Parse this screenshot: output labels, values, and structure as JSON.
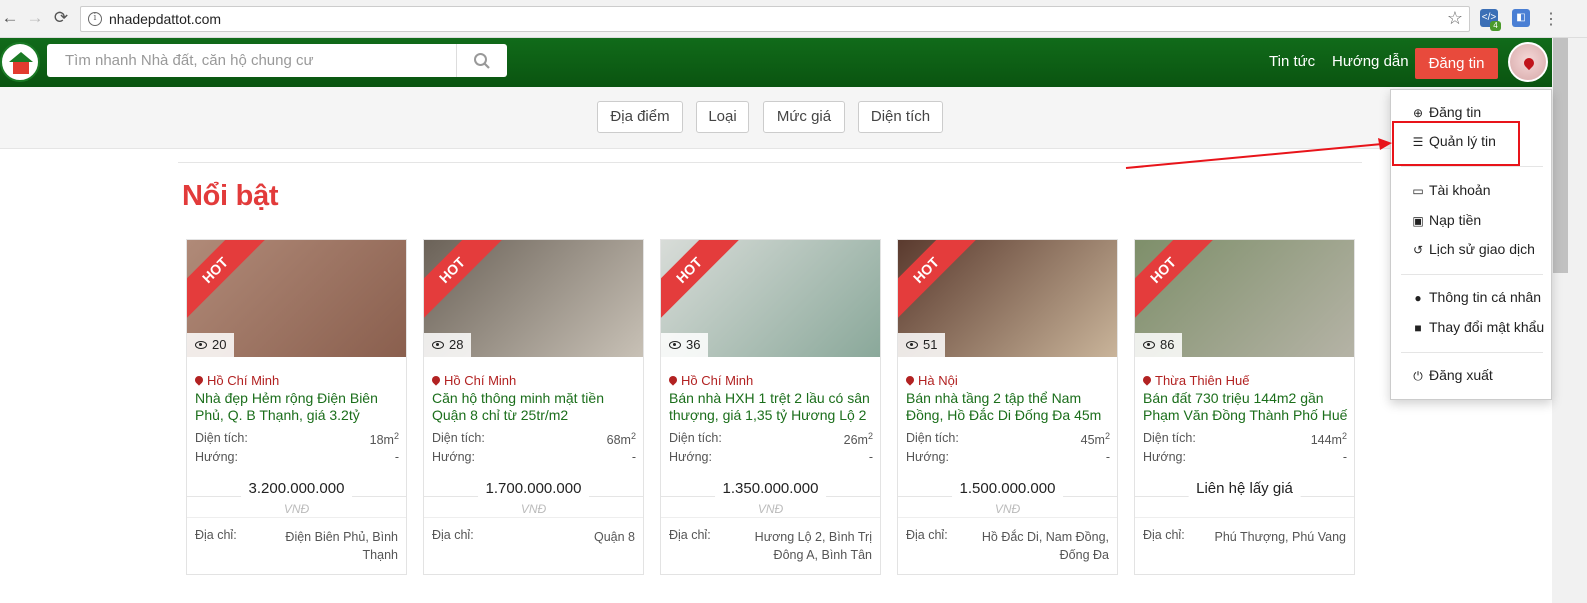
{
  "browser": {
    "back_icon": "arrow-left-icon",
    "forward_icon": "arrow-right-icon",
    "reload_icon": "reload-icon",
    "url": "nhadepdattot.com",
    "ext_badge": "4"
  },
  "header": {
    "search_placeholder": "Tìm nhanh Nhà đất, căn hộ chung cư",
    "news": "Tin tức",
    "guide": "Hướng dẫn",
    "post_button": "Đăng tin"
  },
  "filters": [
    "Địa điểm",
    "Loại",
    "Mức giá",
    "Diện tích"
  ],
  "section_title": "Nổi bật",
  "labels": {
    "hot": "HOT",
    "area": "Diện tích:",
    "direction": "Hướng:",
    "currency": "VNĐ",
    "address": "Địa chỉ:"
  },
  "listings": [
    {
      "views": "20",
      "location": "Hồ Chí Minh",
      "title": "Nhà đẹp Hẻm rộng Điện Biên Phủ, Q. B Thạnh, giá 3.2tỷ",
      "area": "18m",
      "direction": "-",
      "price": "3.200.000.000",
      "address": "Điện Biên Phủ, Bình Thạnh",
      "photo_colors": [
        "#b08a78",
        "#8a5f4e"
      ]
    },
    {
      "views": "28",
      "location": "Hồ Chí Minh",
      "title": "Căn hộ thông minh mặt tiền Quận 8 chỉ từ 25tr/m2",
      "area": "68m",
      "direction": "-",
      "price": "1.700.000.000",
      "address": "Quận 8",
      "photo_colors": [
        "#6b6258",
        "#c8c1b6"
      ]
    },
    {
      "views": "36",
      "location": "Hồ Chí Minh",
      "title": "Bán nhà HXH 1 trệt 2 lầu có sân thượng, giá 1,35 tỷ Hương Lộ 2",
      "area": "26m",
      "direction": "-",
      "price": "1.350.000.000",
      "address": "Hương Lộ 2, Bình Trị Đông A, Bình Tân",
      "photo_colors": [
        "#d8dcd8",
        "#8aa89a"
      ]
    },
    {
      "views": "51",
      "location": "Hà Nội",
      "title": "Bán nhà tầng 2 tập thể Nam Đồng, Hồ Đắc Di Đống Đa 45m",
      "area": "45m",
      "direction": "-",
      "price": "1.500.000.000",
      "address": "Hồ Đắc Di, Nam Đồng, Đống Đa",
      "photo_colors": [
        "#5a3a2e",
        "#c9b49a"
      ]
    },
    {
      "views": "86",
      "location": "Thừa Thiên Huế",
      "title": "Bán đất 730 triệu 144m2 gần Phạm Văn Đồng Thành Phố Huế",
      "area": "144m",
      "direction": "-",
      "price": "Liên hệ lấy giá",
      "address": "Phú Thượng, Phú Vang",
      "photo_colors": [
        "#7e8f6a",
        "#b5b3a6"
      ]
    }
  ],
  "dropdown": {
    "items": [
      {
        "icon": "plus-circle-icon",
        "label": "Đăng tin"
      },
      {
        "icon": "list-icon",
        "label": "Quản lý tin"
      },
      {
        "icon": "credit-card-icon",
        "label": "Tài khoản"
      },
      {
        "icon": "money-icon",
        "label": "Nạp tiền"
      },
      {
        "icon": "history-icon",
        "label": "Lịch sử giao dịch"
      },
      {
        "icon": "user-icon",
        "label": "Thông tin cá nhân"
      },
      {
        "icon": "lock-icon",
        "label": "Thay đổi mật khẩu"
      },
      {
        "icon": "power-icon",
        "label": "Đăng xuất"
      }
    ]
  },
  "colors": {
    "header_green": "#0f6117",
    "accent_red": "#e84a3c",
    "title_green": "#1b6e1b",
    "annotation_red": "#e8141a"
  }
}
